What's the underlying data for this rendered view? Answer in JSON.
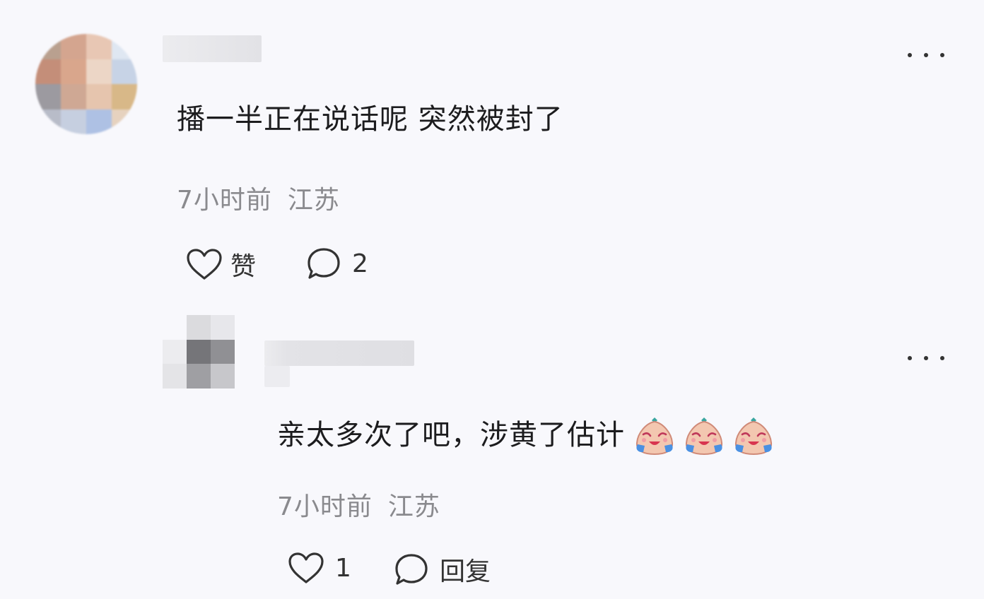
{
  "comment": {
    "text": "播一半正在说话呢 突然被封了",
    "time": "7小时前",
    "location": "江苏",
    "like_label": "赞",
    "reply_count": "2",
    "more_icon": "more-horizontal-icon"
  },
  "reply": {
    "text": "亲太多次了吧，涉黄了估计",
    "emoji_icon": "crying-laugh-emoji",
    "emoji_count": 3,
    "time": "7小时前",
    "location": "江苏",
    "like_count": "1",
    "reply_label": "回复",
    "more_icon": "more-horizontal-icon"
  },
  "colors": {
    "background": "#f8f8fc",
    "text": "#1c1c1e",
    "meta": "#8a8a8e",
    "icon": "#333333"
  }
}
